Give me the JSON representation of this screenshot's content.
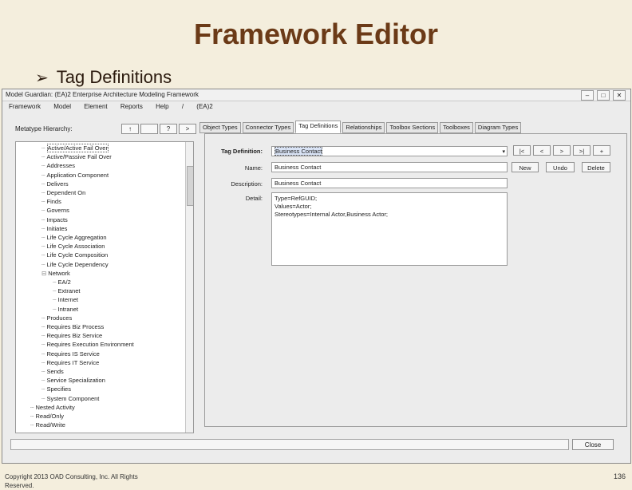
{
  "slide": {
    "title": "Framework Editor",
    "bullet": "Tag Definitions",
    "footer": "Copyright 2013 OAD Consulting, Inc. All Rights Reserved.",
    "page_number": "136"
  },
  "window": {
    "title": "Model Guardian: (EA)2 Enterprise Architecture Modeling Framework",
    "controls": [
      "–",
      "□",
      "✕"
    ]
  },
  "menu": [
    "Framework",
    "Model",
    "Element",
    "Reports",
    "Help",
    "/",
    "(EA)2"
  ],
  "hierarchy": {
    "label": "Metatype Hierarchy:",
    "buttons": [
      "↑",
      "",
      "?",
      ">"
    ],
    "items": [
      {
        "label": "Active/Active Fail Over",
        "indent": 2,
        "selected": true
      },
      {
        "label": "Active/Passive Fail Over",
        "indent": 2
      },
      {
        "label": "Addresses",
        "indent": 2
      },
      {
        "label": "Application Component",
        "indent": 2
      },
      {
        "label": "Delivers",
        "indent": 2
      },
      {
        "label": "Dependent On",
        "indent": 2
      },
      {
        "label": "Finds",
        "indent": 2
      },
      {
        "label": "Governs",
        "indent": 2
      },
      {
        "label": "Impacts",
        "indent": 2
      },
      {
        "label": "Initiates",
        "indent": 2
      },
      {
        "label": "Life Cycle Aggregation",
        "indent": 2
      },
      {
        "label": "Life Cycle Association",
        "indent": 2
      },
      {
        "label": "Life Cycle Composition",
        "indent": 2
      },
      {
        "label": "Life Cycle Dependency",
        "indent": 2
      },
      {
        "label": "Network",
        "indent": 2,
        "expanded": true
      },
      {
        "label": "EA/2",
        "indent": 3
      },
      {
        "label": "Extranet",
        "indent": 3
      },
      {
        "label": "Internet",
        "indent": 3
      },
      {
        "label": "Intranet",
        "indent": 3
      },
      {
        "label": "Produces",
        "indent": 2
      },
      {
        "label": "Requires Biz Process",
        "indent": 2
      },
      {
        "label": "Requires Biz Service",
        "indent": 2
      },
      {
        "label": "Requires Execution Environment",
        "indent": 2
      },
      {
        "label": "Requires IS Service",
        "indent": 2
      },
      {
        "label": "Requires IT Service",
        "indent": 2
      },
      {
        "label": "Sends",
        "indent": 2
      },
      {
        "label": "Service Specialization",
        "indent": 2
      },
      {
        "label": "Specifies",
        "indent": 2
      },
      {
        "label": "System Component",
        "indent": 2
      },
      {
        "label": "Nested Activity",
        "indent": 1
      },
      {
        "label": "Read/Only",
        "indent": 1
      },
      {
        "label": "Read/Write",
        "indent": 1
      }
    ]
  },
  "tabs": [
    {
      "label": "Object Types"
    },
    {
      "label": "Connector Types"
    },
    {
      "label": "Tag Definitions",
      "active": true
    },
    {
      "label": "Relationships"
    },
    {
      "label": "Toolbox Sections"
    },
    {
      "label": "Toolboxes"
    },
    {
      "label": "Diagram Types"
    }
  ],
  "form": {
    "tag_definition_label": "Tag Definition:",
    "tag_definition_value": "Business Contact",
    "name_label": "Name:",
    "name_value": "Business Contact",
    "description_label": "Description:",
    "description_value": "Business Contact",
    "detail_label": "Detail:",
    "detail_lines": [
      "Type=RefGUID;",
      "Values=Actor;",
      "Stereotypes=Internal Actor,Business Actor;"
    ],
    "nav_buttons": [
      "|<",
      "<",
      ">",
      ">|",
      "+"
    ],
    "new_button": "New",
    "undo_button": "Undo",
    "delete_button": "Delete"
  },
  "bottom": {
    "close_button": "Close"
  }
}
